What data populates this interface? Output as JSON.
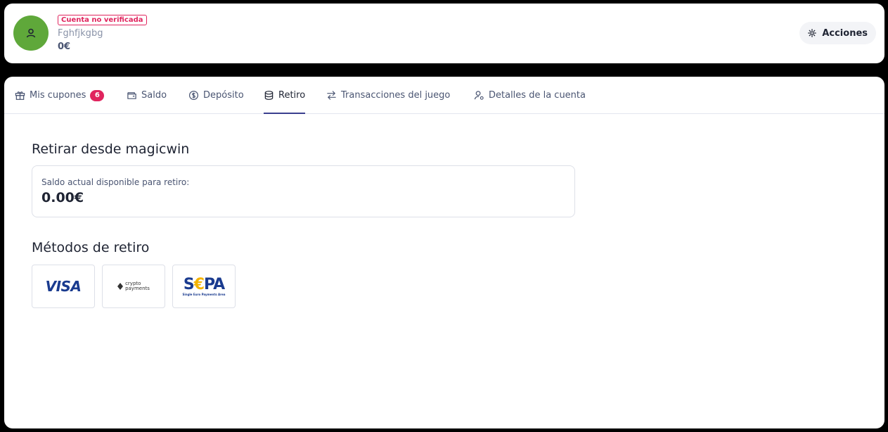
{
  "header": {
    "status_badge": "Cuenta no verificada",
    "username": "Fghfjkgbg",
    "balance": "0€",
    "actions_label": "Acciones"
  },
  "tabs": [
    {
      "label": "Mis cupones",
      "icon": "gift-icon",
      "badge": "6"
    },
    {
      "label": "Saldo",
      "icon": "wallet-icon"
    },
    {
      "label": "Depósito",
      "icon": "dollar-circle-icon"
    },
    {
      "label": "Retiro",
      "icon": "database-icon",
      "active": true
    },
    {
      "label": "Transacciones del juego",
      "icon": "arrows-swap-icon"
    },
    {
      "label": "Detalles de la cuenta",
      "icon": "user-gear-icon"
    }
  ],
  "withdraw": {
    "title": "Retirar desde magicwin",
    "available_label": "Saldo actual disponible para retiro:",
    "available_value": "0.00€"
  },
  "methods": {
    "title": "Métodos de retiro",
    "items": [
      {
        "name": "VISA",
        "logo_text": "VISA"
      },
      {
        "name": "crypto payments",
        "logo_line1": "crypto",
        "logo_line2": "payments"
      },
      {
        "name": "SEPA",
        "logo_left": "S",
        "logo_euro": "€",
        "logo_right": "PA",
        "logo_sub": "Single Euro Payments Area"
      }
    ]
  },
  "colors": {
    "accent": "#3b3f8f",
    "badge": "#e0245e",
    "avatar": "#5fa83a"
  }
}
